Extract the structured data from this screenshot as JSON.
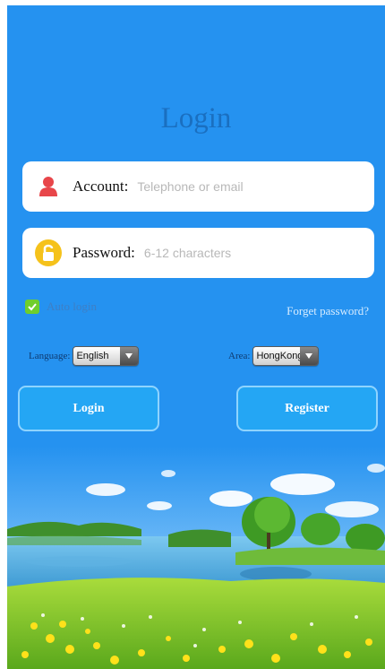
{
  "header": {
    "title": "Login"
  },
  "account": {
    "label": "Account:",
    "placeholder": "Telephone or email",
    "value": ""
  },
  "password": {
    "label": "Password:",
    "placeholder": "6-12 characters",
    "value": ""
  },
  "auto_login": {
    "label": "Auto login",
    "checked": true
  },
  "forget_password": {
    "label": "Forget password?"
  },
  "language": {
    "label": "Language:",
    "selected": "English"
  },
  "area": {
    "label": "Area:",
    "selected": "HongKong"
  },
  "buttons": {
    "login": "Login",
    "register": "Register"
  },
  "colors": {
    "background": "#2592f0",
    "title": "#1a6fc0",
    "button_fill": "#24a6f4",
    "button_border": "#8fd4ff",
    "checkbox": "#6fce2c",
    "account_icon": "#e8464a",
    "password_icon": "#f5c21b"
  },
  "icons": {
    "account": "person-icon",
    "password": "lock-icon",
    "checkbox": "check-icon",
    "dropdown": "chevron-down-icon"
  }
}
